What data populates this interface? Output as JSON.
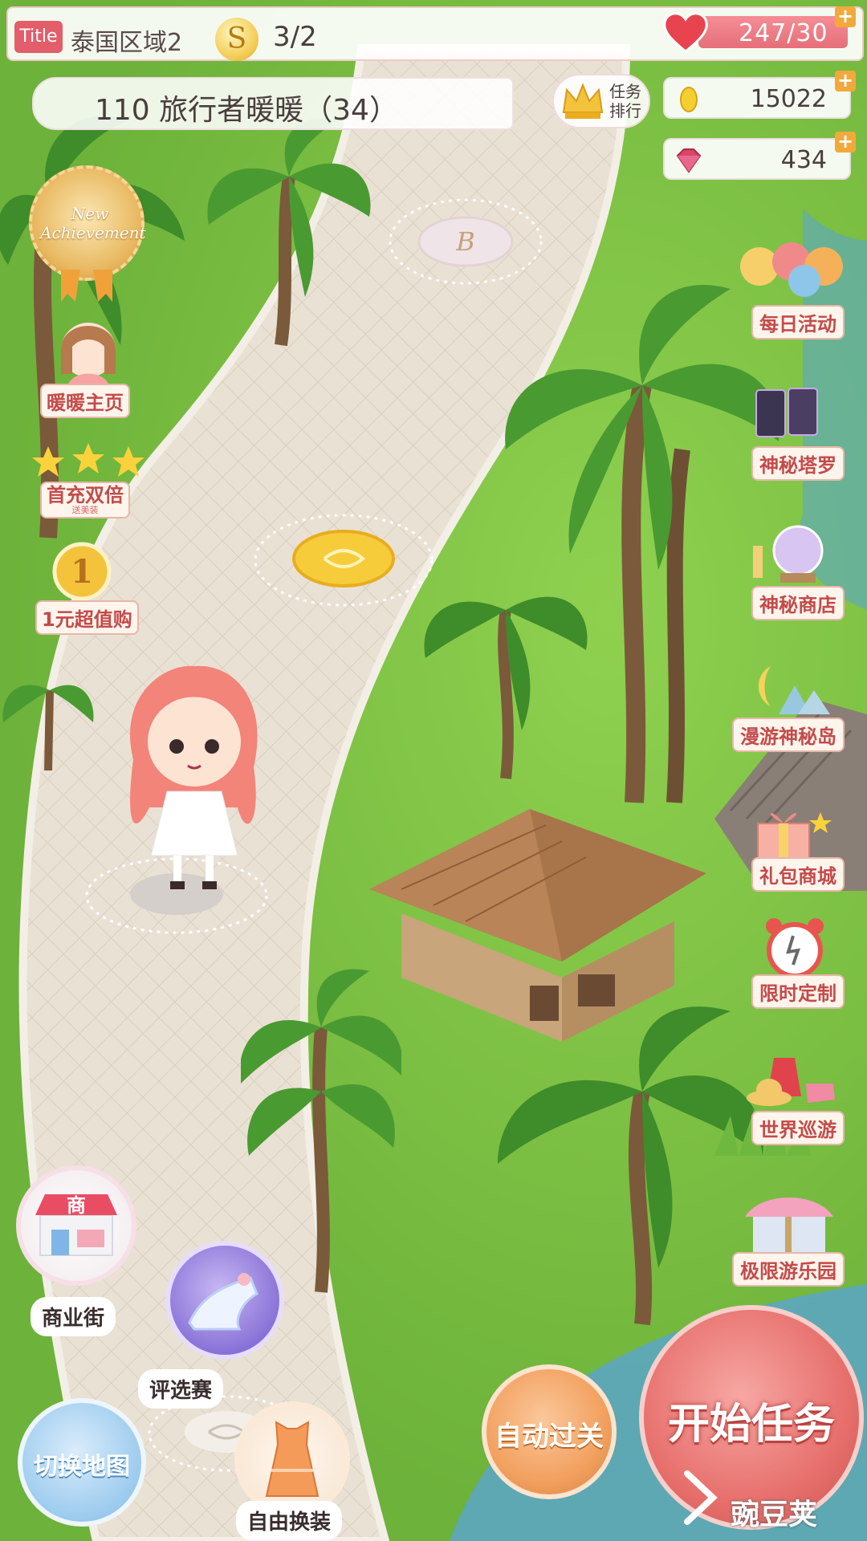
{
  "topbar": {
    "title_badge": "Title",
    "region": "泰国区域2",
    "coin_symbol": "S",
    "stage_count": "3/2",
    "stamina": "247/30"
  },
  "level": {
    "name": "110 旅行者暖暖（34）"
  },
  "rank": {
    "label_line1": "任务",
    "label_line2": "排行"
  },
  "currency": {
    "gold": "15022",
    "diamond": "434"
  },
  "achievement": {
    "line1": "New",
    "line2": "Achievement"
  },
  "left_menu": {
    "home": "暖暖主页",
    "double": "首充双倍",
    "double_sub": "送美装",
    "one_yuan_badge": "1",
    "one_yuan": "1元超值购"
  },
  "right_menu": {
    "daily": "每日活动",
    "tarot": "神秘塔罗",
    "shop": "神秘商店",
    "island": "漫游神秘岛",
    "gift": "礼包商城",
    "custom": "限时定制",
    "world": "世界巡游",
    "park": "极限游乐园"
  },
  "bottom": {
    "commerce_icon_text": "商",
    "commerce": "商业街",
    "contest": "评选赛",
    "switch_map": "切换地图",
    "dress": "自由换装",
    "auto": "自动过关",
    "start": "开始任务"
  },
  "map": {
    "node_b_label": "B"
  },
  "watermark": "豌豆荚",
  "colors": {
    "accent_red": "#e35d6a",
    "start_button": "#e7706d",
    "auto_button": "#f2a160",
    "grass": "#7cc545"
  }
}
